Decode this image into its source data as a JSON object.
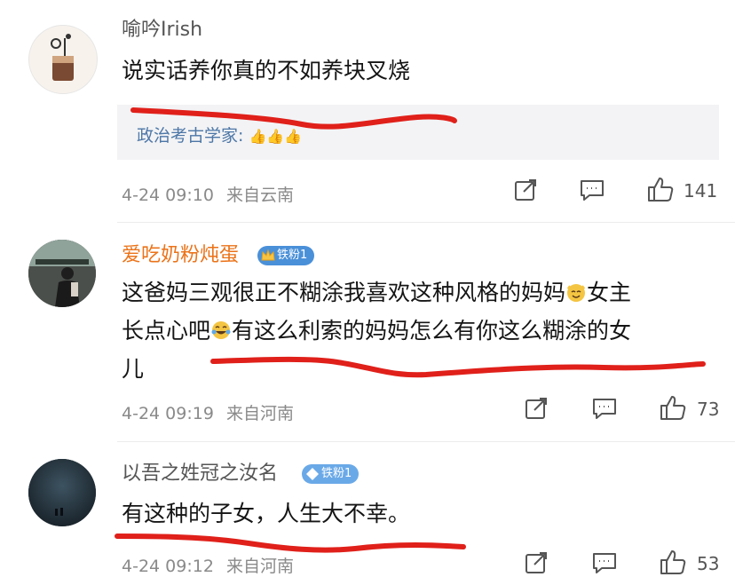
{
  "comments": [
    {
      "username": "喻吟Irish",
      "text": "说实话养你真的不如养块叉烧",
      "quote": "政治考古学家:",
      "time": "4-24 09:10",
      "location": "来自云南",
      "likes": "141"
    },
    {
      "username": "爱吃奶粉炖蛋",
      "badge": "铁粉1",
      "text_line1": "这爸妈三观很正不糊涂我喜欢这种风格的妈妈",
      "text_line1b": "女主",
      "text_line2a": "长点心吧",
      "text_line2b": "有这么利索的妈妈怎么有你这么糊涂的女",
      "text_line3": "儿",
      "time": "4-24 09:19",
      "location": "来自河南",
      "likes": "73"
    },
    {
      "username": "以吾之姓冠之汝名",
      "badge": "铁粉1",
      "text": "有这种的子女，人生大不幸。",
      "time": "4-24 09:12",
      "location": "来自河南",
      "likes": "53"
    }
  ],
  "colors": {
    "red_annotation": "#e0201a",
    "username_highlight": "#eb7319"
  }
}
